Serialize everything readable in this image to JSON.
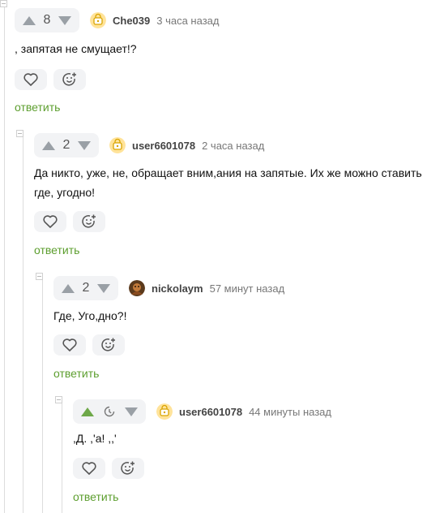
{
  "comments": [
    {
      "votes": "8",
      "user": "Che039",
      "time": "3 часа назад",
      "text": ", запятая не смущает!?",
      "reply": "ответить"
    },
    {
      "votes": "2",
      "user": "user6601078",
      "time": "2 часа назад",
      "text": "Да никто, уже, не, обращает вним,ания на запятые. Их же можно ставить где, угодно!",
      "reply": "ответить"
    },
    {
      "votes": "2",
      "user": "nickolaym",
      "time": "57 минут назад",
      "text": "Где, Уго,дно?!",
      "reply": "ответить"
    },
    {
      "user": "user6601078",
      "time": "44 минуты назад",
      "text": ",Д. ,'а! ,,'",
      "reply": "ответить"
    }
  ],
  "icons": {
    "upvote": "arrow-up-icon",
    "downvote": "arrow-down-icon",
    "like": "heart-icon",
    "emoji": "emoji-add-icon",
    "collapse": "collapse-icon",
    "pending": "clock-icon"
  },
  "colors": {
    "accent_green": "#6ea849",
    "reply_green": "#5c9e2e",
    "button_bg": "#f2f3f5"
  }
}
